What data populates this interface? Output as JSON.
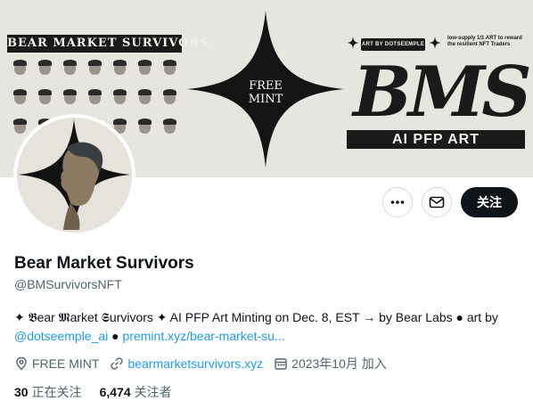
{
  "banner": {
    "title": "BEAR MARKET SURVIVORS",
    "star_line1": "FREE",
    "star_line2": "MINT",
    "tag": "ART BY DOTSEEMPLE",
    "note": "low-supply 1/1 ART to reward the resilient NFT Traders",
    "logo": "BMS",
    "subtitle": "AI PFP ART"
  },
  "actions": {
    "more_icon": "more-icon",
    "message_icon": "envelope-icon",
    "follow_label": "关注"
  },
  "profile": {
    "name": "Bear Market Survivors",
    "handle": "@BMSurvivorsNFT",
    "bio": {
      "prefix": "✦ 𝕭ear 𝕸arket 𝕾urvivors ✦ AI PFP Art Minting on Dec. 8, EST → by Bear Labs ● art by ",
      "mention": "@dotseemple_ai",
      "sep": " ● ",
      "url": "premint.xyz/bear-market-su..."
    },
    "location": "FREE MINT",
    "website": "bearmarketsurvivors.xyz",
    "joined": "2023年10月 加入",
    "following_count": "30",
    "following_label": "正在关注",
    "followers_count": "6,474",
    "followers_label": "关注者"
  },
  "colors": {
    "link": "#1d9bf0",
    "muted": "#536471",
    "text": "#0f1419",
    "banner_bg": "#e7e5df"
  }
}
